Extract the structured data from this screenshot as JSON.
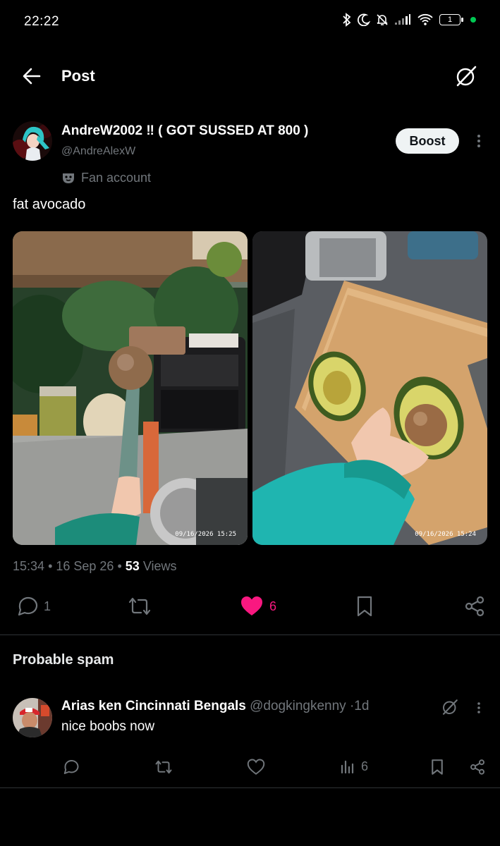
{
  "status": {
    "time": "22:22",
    "battery": "1"
  },
  "header": {
    "title": "Post"
  },
  "post": {
    "author_name": "AndreW2002 ‼ ( GOT SUSSED AT 800 )",
    "handle": "@AndreAlexW",
    "boost_label": "Boost",
    "badge_label": "Fan account",
    "text": "fat avocado",
    "photo1_stamp": "09/16/2026  15:25",
    "photo2_stamp": "09/16/2026  15:24",
    "time": "15:34",
    "date": "16 Sep 26",
    "views_count": "53",
    "views_label": "Views",
    "replies": "1",
    "likes": "6",
    "like_color": "#f91880"
  },
  "spam_section": {
    "title": "Probable spam"
  },
  "reply": {
    "name": "Arias ken Cincinnati Bengals",
    "handle": "@dogkingkenny",
    "sep": "·",
    "age": "1d",
    "text": "nice boobs now",
    "views": "6"
  },
  "icons": [
    "arrow-left-icon",
    "grok-icon",
    "mask-icon",
    "comment-icon",
    "retweet-icon",
    "heart-icon",
    "bookmark-icon",
    "share-icon",
    "analytics-icon"
  ]
}
